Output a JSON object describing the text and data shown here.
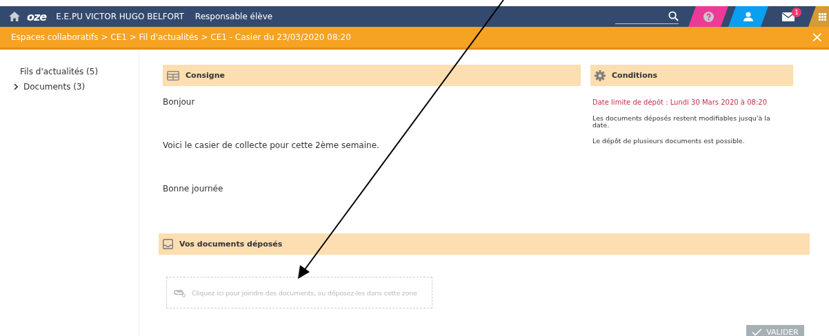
{
  "navbar": {
    "logo": "oze",
    "school": "E.E.PU VICTOR HUGO BELFORT",
    "role": "Responsable élève",
    "mail_badge": "1"
  },
  "breadcrumb": {
    "text": "Espaces collaboratifs > CE1  > Fil d'actualités > CE1 - Casier du 23/03/2020 08:20",
    "close": "×"
  },
  "sidebar": {
    "items": [
      {
        "label": "Fils d'actualités (5)",
        "kind": "plain"
      },
      {
        "label": "Documents (3)",
        "kind": "folder"
      }
    ]
  },
  "consigne": {
    "title": "Consigne",
    "paragraphs": [
      "Bonjour",
      "Voici le casier de collecte pour cette 2ème semaine.",
      "Bonne journée"
    ]
  },
  "conditions": {
    "title": "Conditions",
    "deadline": "Date limite de dépôt :  Lundi 30 Mars 2020 à 08:20",
    "notes": [
      "Les documents déposés restent modifiables jusqu'à la date.",
      "Le dépôt de plusieurs documents est possible."
    ]
  },
  "deposited": {
    "title": "Vos documents déposés",
    "dropzone": "Cliquez ici pour joindre des documents, ou déposez-les dans cette zone"
  },
  "validate_button": "VALIDER"
}
